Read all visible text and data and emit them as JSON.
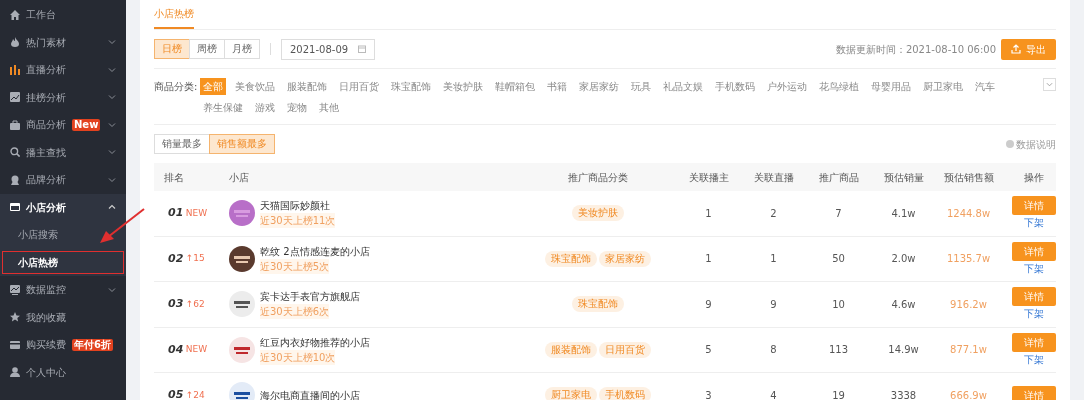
{
  "sidebar": {
    "items": [
      {
        "label": "工作台",
        "selected": false
      },
      {
        "label": "热门素材",
        "selected": false,
        "expanded": false
      },
      {
        "label": "直播分析",
        "selected": false,
        "expanded": false
      },
      {
        "label": "挂榜分析",
        "selected": false,
        "expanded": false
      },
      {
        "label": "商品分析",
        "selected": false,
        "expanded": false,
        "badge": "New"
      },
      {
        "label": "播主查找",
        "selected": false,
        "expanded": false
      },
      {
        "label": "品牌分析",
        "selected": false,
        "expanded": false
      },
      {
        "label": "小店分析",
        "selected": true,
        "expanded": true,
        "children": [
          {
            "label": "小店搜索",
            "selected": false
          },
          {
            "label": "小店热榜",
            "selected": true,
            "highlighted": true
          }
        ]
      },
      {
        "label": "数据监控",
        "selected": false,
        "expanded": false
      },
      {
        "label": "我的收藏",
        "selected": false
      },
      {
        "label": "购买续费",
        "selected": false,
        "badge": "年付6折"
      },
      {
        "label": "个人中心",
        "selected": false
      }
    ]
  },
  "tabs": [
    {
      "label": "小店热榜",
      "selected": true
    }
  ],
  "period_tabs": [
    {
      "label": "日榜",
      "selected": true
    },
    {
      "label": "周榜",
      "selected": false
    },
    {
      "label": "月榜",
      "selected": false
    }
  ],
  "date_field": {
    "value": "2021-08-09"
  },
  "update_time": "数据更新时间：2021-08-10 06:00",
  "export_button": "导出",
  "category_filter": {
    "label": "商品分类:",
    "options": [
      {
        "label": "全部",
        "selected": true
      },
      {
        "label": "美食饮品",
        "selected": false
      },
      {
        "label": "服装配饰",
        "selected": false
      },
      {
        "label": "日用百货",
        "selected": false
      },
      {
        "label": "珠宝配饰",
        "selected": false
      },
      {
        "label": "美妆护肤",
        "selected": false
      },
      {
        "label": "鞋帽箱包",
        "selected": false
      },
      {
        "label": "书籍",
        "selected": false
      },
      {
        "label": "家居家纺",
        "selected": false
      },
      {
        "label": "玩具",
        "selected": false
      },
      {
        "label": "礼品文娱",
        "selected": false
      },
      {
        "label": "手机数码",
        "selected": false
      },
      {
        "label": "户外运动",
        "selected": false
      },
      {
        "label": "花鸟绿植",
        "selected": false
      },
      {
        "label": "母婴用品",
        "selected": false
      },
      {
        "label": "厨卫家电",
        "selected": false
      },
      {
        "label": "汽车",
        "selected": false
      },
      {
        "label": "养生保健",
        "selected": false
      },
      {
        "label": "游戏",
        "selected": false
      },
      {
        "label": "宠物",
        "selected": false
      },
      {
        "label": "其他",
        "selected": false
      }
    ]
  },
  "sort_tabs": [
    {
      "label": "销量最多",
      "selected": false
    },
    {
      "label": "销售额最多",
      "selected": true
    }
  ],
  "data_note": "数据说明",
  "table": {
    "columns": [
      "排名",
      "小店",
      "推广商品分类",
      "关联播主",
      "关联直播",
      "推广商品",
      "预估销量",
      "预估销售额",
      "操作"
    ],
    "rows": [
      {
        "rank": "01",
        "change": "NEW",
        "shop": "天猫国际妙颜社",
        "subtitle": "近30天上榜11次",
        "tags": [
          "美妆护肤"
        ],
        "anchors": "1",
        "lives": "2",
        "products": "7",
        "sales": "4.1w",
        "revenue": "1244.8w",
        "action": "详情",
        "link": "下架"
      },
      {
        "rank": "02",
        "change": "↑15",
        "shop": "乾纹 2点情感连麦的小店",
        "subtitle": "近30天上榜5次",
        "tags": [
          "珠宝配饰",
          "家居家纺"
        ],
        "anchors": "1",
        "lives": "1",
        "products": "50",
        "sales": "2.0w",
        "revenue": "1135.7w",
        "action": "详情",
        "link": "下架"
      },
      {
        "rank": "03",
        "change": "↑62",
        "shop": "宾卡达手表官方旗舰店",
        "subtitle": "近30天上榜6次",
        "tags": [
          "珠宝配饰"
        ],
        "anchors": "9",
        "lives": "9",
        "products": "10",
        "sales": "4.6w",
        "revenue": "916.2w",
        "action": "详情",
        "link": "下架"
      },
      {
        "rank": "04",
        "change": "NEW",
        "shop": "红豆内衣好物推荐的小店",
        "subtitle": "近30天上榜10次",
        "tags": [
          "服装配饰",
          "日用百货"
        ],
        "anchors": "5",
        "lives": "8",
        "products": "113",
        "sales": "14.9w",
        "revenue": "877.1w",
        "action": "详情",
        "link": "下架"
      },
      {
        "rank": "05",
        "change": "↑24",
        "shop": "海尔电商直播间的小店",
        "tags": [
          "厨卫家电",
          "手机数码"
        ],
        "anchors": "3",
        "lives": "4",
        "products": "19",
        "sales": "3338",
        "revenue": "666.9w",
        "action": "详情"
      }
    ]
  }
}
